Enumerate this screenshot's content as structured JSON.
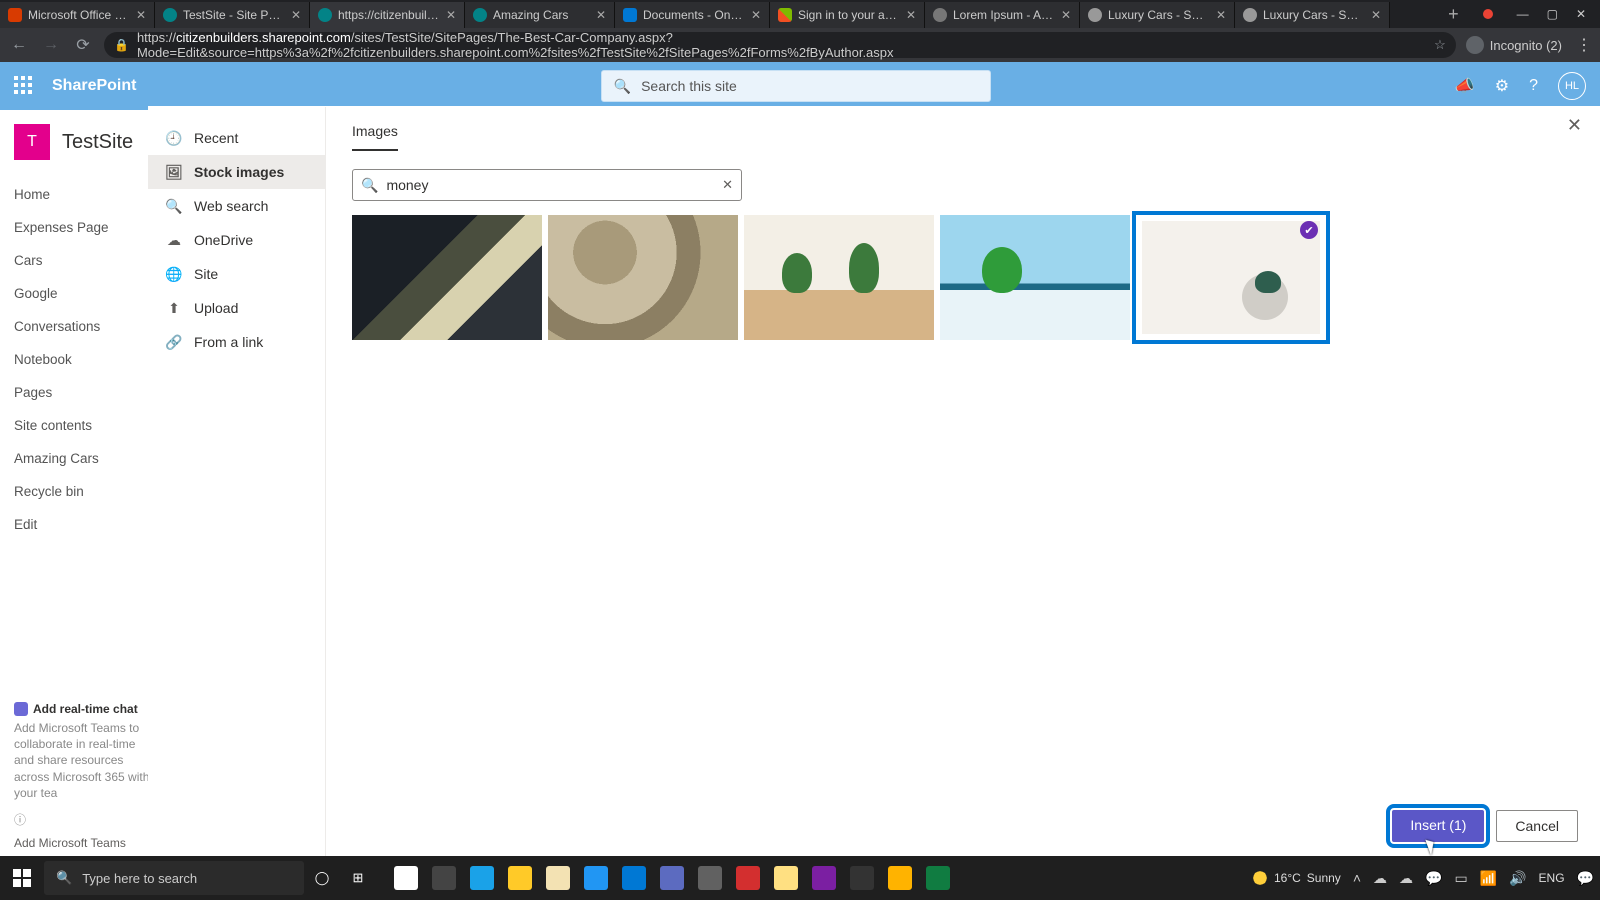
{
  "browser": {
    "tabs": [
      {
        "label": "Microsoft Office Home",
        "fav": "fav-o"
      },
      {
        "label": "TestSite - Site Pages -",
        "fav": "fav-sp"
      },
      {
        "label": "https://citizenbuilders",
        "fav": "fav-sp",
        "active": true
      },
      {
        "label": "Amazing Cars",
        "fav": "fav-sp"
      },
      {
        "label": "Documents - OneDriv",
        "fav": "fav-od"
      },
      {
        "label": "Sign in to your accoun",
        "fav": "fav-ms"
      },
      {
        "label": "Lorem Ipsum - All the",
        "fav": "fav-lo"
      },
      {
        "label": "Luxury Cars - Sedans,",
        "fav": "fav-mb"
      },
      {
        "label": "Luxury Cars - Sedans,",
        "fav": "fav-mb"
      }
    ],
    "url_prefix": "https://",
    "url_domain": "citizenbuilders.sharepoint.com",
    "url_path": "/sites/TestSite/SitePages/The-Best-Car-Company.aspx?Mode=Edit&source=https%3a%2f%2fcitizenbuilders.sharepoint.com%2fsites%2fTestSite%2fSitePages%2fForms%2fByAuthor.aspx",
    "incognito_label": "Incognito (2)"
  },
  "suite": {
    "brand": "SharePoint",
    "search_placeholder": "Search this site",
    "avatar": "HL"
  },
  "site": {
    "logo_letter": "T",
    "name": "TestSite",
    "nav": [
      "Home",
      "Expenses Page",
      "Cars",
      "Google",
      "Conversations",
      "Notebook",
      "Pages",
      "Site contents",
      "Amazing Cars",
      "Recycle bin",
      "Edit"
    ],
    "chat_header": "Add real-time chat",
    "chat_body": "Add Microsoft Teams to collaborate in real-time and share resources across Microsoft 365 with your tea",
    "chat_link": "Add Microsoft Teams"
  },
  "picker": {
    "tab_label": "Images",
    "search_value": "money",
    "sources": [
      {
        "icon": "🕘",
        "label": "Recent"
      },
      {
        "icon": "🖼",
        "label": "Stock images",
        "active": true
      },
      {
        "icon": "🔍",
        "label": "Web search"
      },
      {
        "icon": "☁",
        "label": "OneDrive"
      },
      {
        "icon": "🌐",
        "label": "Site"
      },
      {
        "icon": "⬆",
        "label": "Upload"
      },
      {
        "icon": "🔗",
        "label": "From a link"
      }
    ],
    "insert_label": "Insert (1)",
    "cancel_label": "Cancel"
  },
  "taskbar": {
    "search_placeholder": "Type here to search",
    "weather_temp": "16°C",
    "weather_cond": "Sunny",
    "lang": "ENG",
    "apps": [
      {
        "c": "#fff",
        "name": "task-view"
      },
      {
        "c": "#444",
        "name": "cortana"
      },
      {
        "c": "#1aa2e8",
        "name": "edge"
      },
      {
        "c": "#ffca28",
        "name": "file-explorer"
      },
      {
        "c": "#f3e2b3",
        "name": "store"
      },
      {
        "c": "#2196f3",
        "name": "app-l"
      },
      {
        "c": "#0078d4",
        "name": "mail"
      },
      {
        "c": "#5c6bc0",
        "name": "app-blue"
      },
      {
        "c": "#616161",
        "name": "app-grey"
      },
      {
        "c": "#d32f2f",
        "name": "app-red"
      },
      {
        "c": "#ffe082",
        "name": "chrome"
      },
      {
        "c": "#7b1fa2",
        "name": "onenote"
      },
      {
        "c": "#333",
        "name": "obs"
      },
      {
        "c": "#ffb300",
        "name": "app-folder"
      },
      {
        "c": "#107c41",
        "name": "excel"
      }
    ]
  }
}
